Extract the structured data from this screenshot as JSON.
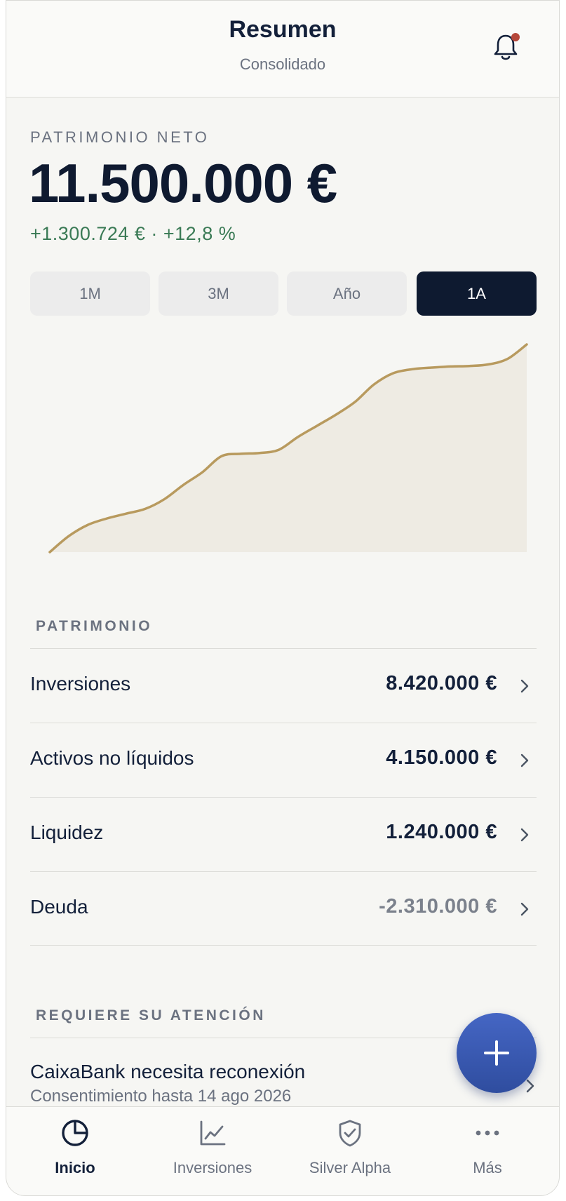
{
  "header": {
    "title": "Resumen",
    "subtitle": "Consolidado",
    "notification_icon": "bell-icon",
    "notification_dot_color": "#b5473a"
  },
  "net_worth": {
    "label": "PATRIMONIO NETO",
    "value": "11.500.000 €",
    "change": "+1.300.724 € · +12,8 %",
    "change_color": "#3a7a55"
  },
  "periods": {
    "options": [
      "1M",
      "3M",
      "Año",
      "1A"
    ],
    "selected": "1A"
  },
  "chart_data": {
    "type": "area",
    "title": "",
    "xlabel": "",
    "ylabel": "",
    "grid": false,
    "line_color": "#b89a5e",
    "fill_color": "#eeebe3",
    "x": [
      0,
      1,
      2,
      3,
      4,
      5,
      6,
      7,
      8,
      9,
      10,
      11,
      12,
      13,
      14,
      15,
      16,
      17,
      18,
      19,
      20,
      21,
      22,
      23,
      24,
      25
    ],
    "values": [
      10199276,
      10300000,
      10370000,
      10410000,
      10440000,
      10470000,
      10530000,
      10620000,
      10700000,
      10800000,
      10815000,
      10820000,
      10840000,
      10920000,
      10990000,
      11060000,
      11140000,
      11250000,
      11320000,
      11345000,
      11355000,
      11362000,
      11365000,
      11375000,
      11410000,
      11500000
    ]
  },
  "assets": {
    "section_label": "PATRIMONIO",
    "rows": [
      {
        "label": "Inversiones",
        "value": "8.420.000 €",
        "negative": false
      },
      {
        "label": "Activos no líquidos",
        "value": "4.150.000 €",
        "negative": false
      },
      {
        "label": "Liquidez",
        "value": "1.240.000 €",
        "negative": false
      },
      {
        "label": "Deuda",
        "value": "-2.310.000 €",
        "negative": true
      }
    ]
  },
  "attention": {
    "section_label": "REQUIERE SU ATENCIÓN",
    "items": [
      {
        "title": "CaixaBank necesita reconexión",
        "subtitle": "Consentimiento hasta 14 ago 2026"
      }
    ]
  },
  "fab": {
    "icon": "plus-icon",
    "color": "#3a5ab4"
  },
  "tabbar": {
    "tabs": [
      {
        "label": "Inicio",
        "icon": "pie-chart-icon",
        "active": true
      },
      {
        "label": "Inversiones",
        "icon": "line-chart-icon",
        "active": false
      },
      {
        "label": "Silver Alpha",
        "icon": "shield-check-icon",
        "active": false
      },
      {
        "label": "Más",
        "icon": "more-dots-icon",
        "active": false
      }
    ]
  }
}
